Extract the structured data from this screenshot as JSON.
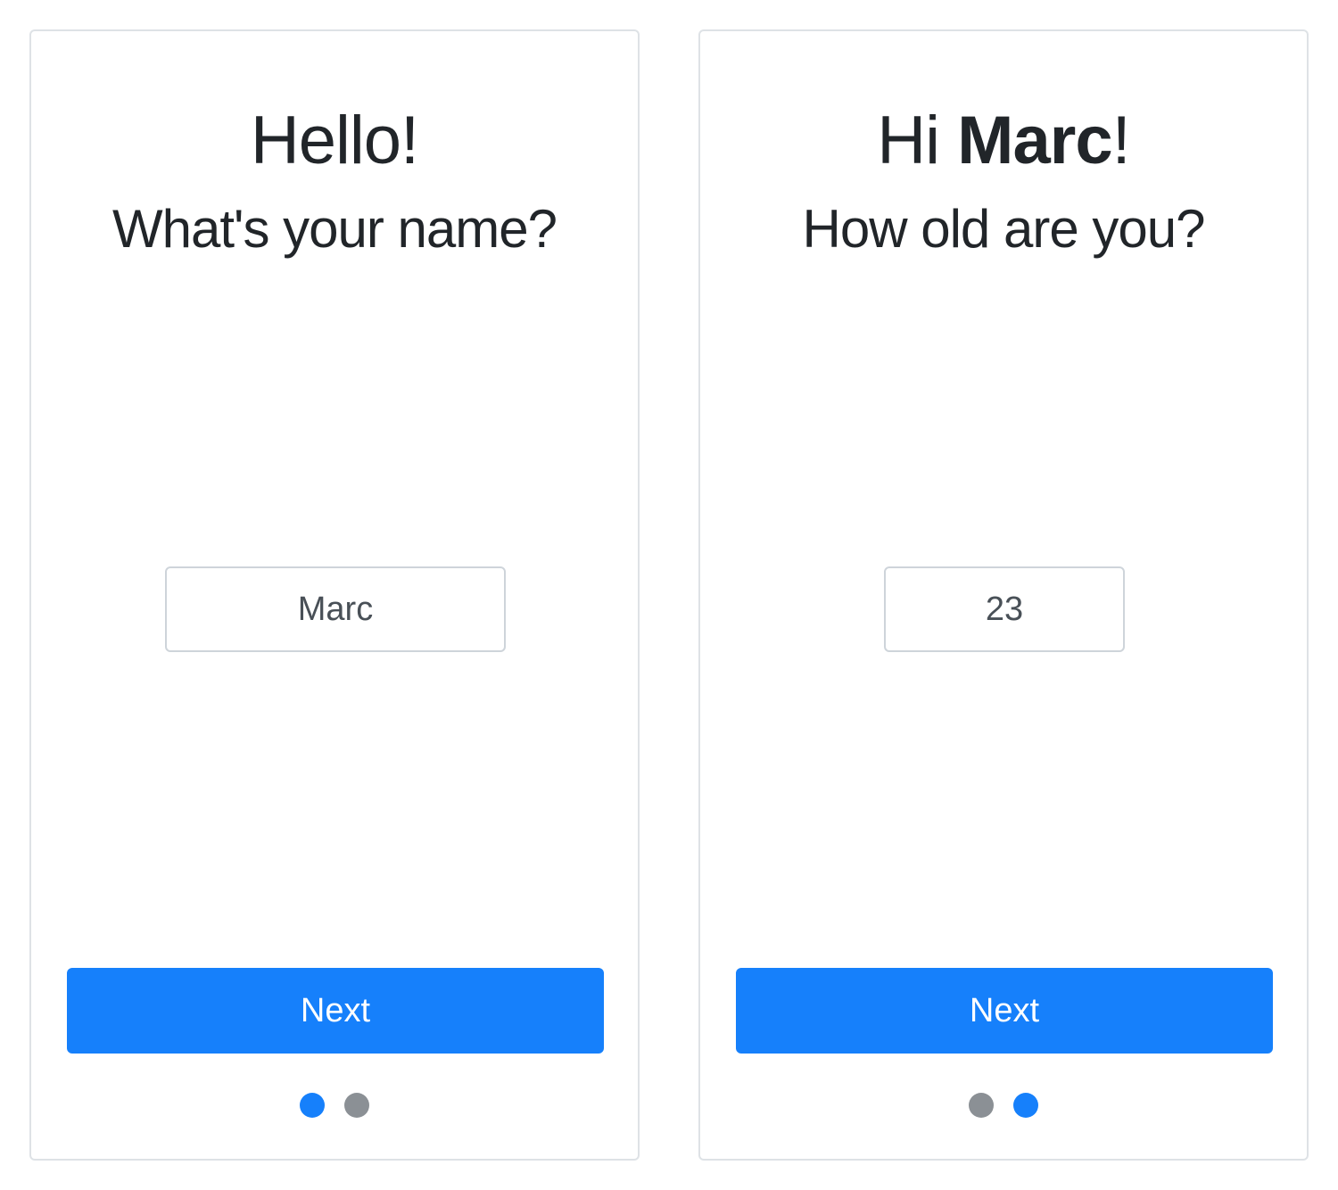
{
  "colors": {
    "accent": "#1680fb",
    "inactive_dot": "#8b9095",
    "text": "#212529",
    "border": "#dee2e6"
  },
  "step1": {
    "heading": "Hello!",
    "question": "What's your name?",
    "input_value": "Marc",
    "next_label": "Next",
    "dots": [
      {
        "state": "active",
        "color": "#1680fb"
      },
      {
        "state": "inactive",
        "color": "#8b9095"
      }
    ]
  },
  "step2": {
    "heading_prefix": "Hi ",
    "heading_name": "Marc",
    "heading_suffix": "!",
    "question": "How old are you?",
    "input_value": "23",
    "next_label": "Next",
    "dots": [
      {
        "state": "inactive",
        "color": "#8b9095"
      },
      {
        "state": "active",
        "color": "#1680fb"
      }
    ]
  }
}
